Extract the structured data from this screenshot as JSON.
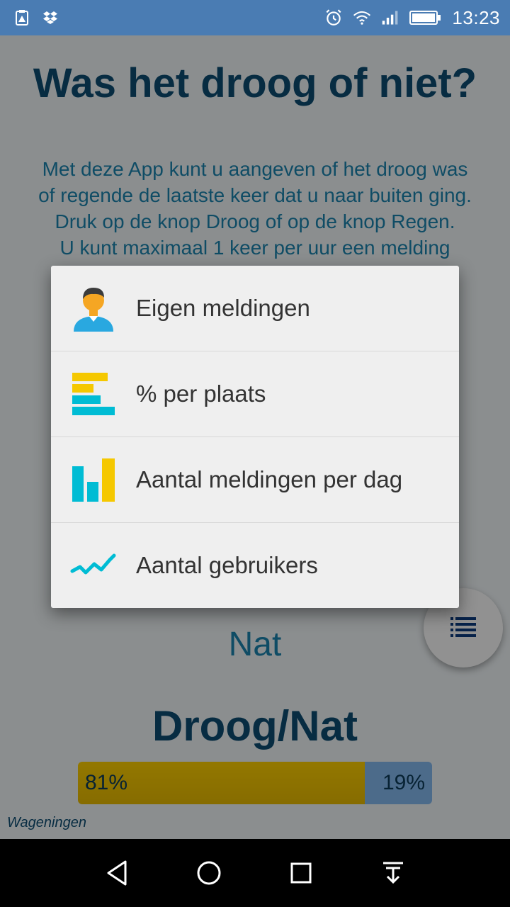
{
  "status_bar": {
    "time": "13:23",
    "icons": [
      "clipboard-warning-icon",
      "dropbox-icon",
      "alarm-icon",
      "wifi-icon",
      "cell-signal-icon",
      "battery-icon"
    ]
  },
  "app": {
    "title": "Was het droog of niet?",
    "intro_lines": [
      "Met deze App kunt u aangeven of het droog was",
      "of regende de laatste keer dat u naar buiten ging.",
      "Druk op de knop Droog of op de knop Regen.",
      "U kunt maximaal 1 keer per uur een melding"
    ],
    "state_label": "Nat",
    "ratio_title": "Droog/Nat",
    "dry_fraction": 0.81,
    "dry_percent_label": "81%",
    "wet_percent_label": "19%",
    "place": "Wageningen"
  },
  "menu": {
    "items": [
      {
        "label": "Eigen meldingen",
        "icon": "person-avatar-icon"
      },
      {
        "label": "% per plaats",
        "icon": "horizontal-bars-icon"
      },
      {
        "label": "Aantal meldingen per dag",
        "icon": "bar-chart-icon"
      },
      {
        "label": "Aantal gebruikers",
        "icon": "line-chart-icon"
      }
    ]
  },
  "colors": {
    "status_bar": "#4a7cb3",
    "title": "#0c4a6e",
    "text": "#1a7fa8",
    "yellow": "#f5c800",
    "cyan": "#00bcd4"
  }
}
